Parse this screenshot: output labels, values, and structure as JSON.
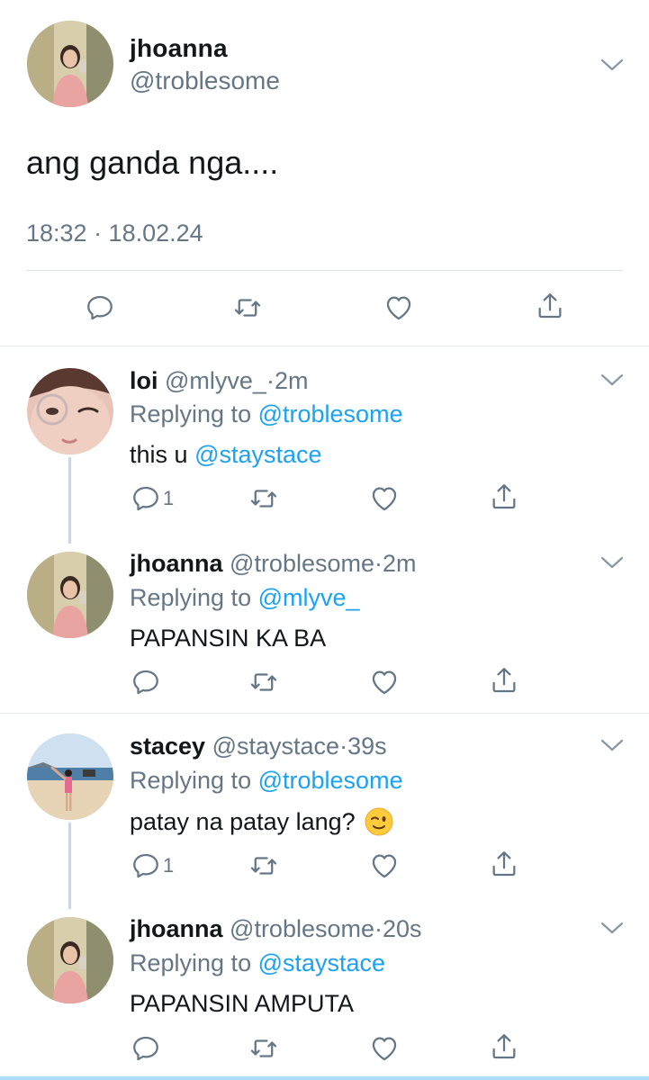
{
  "main_tweet": {
    "name": "jhoanna",
    "handle": "@troblesome",
    "text": "ang ganda nga....",
    "timestamp": "18:32 · 18.02.24",
    "actions": [
      "reply-icon",
      "retweet-icon",
      "like-icon",
      "share-icon"
    ]
  },
  "replies": [
    {
      "name": "loi",
      "handle": "@mlyve_",
      "dot": "·",
      "time": "2m",
      "replying_prefix": "Replying to",
      "replying_to": "@troblesome",
      "text": "this u",
      "text_mention": "@staystace",
      "reply_count": "1"
    },
    {
      "name": "jhoanna",
      "handle": "@troblesome",
      "dot": "·",
      "time": "2m",
      "replying_prefix": "Replying to",
      "replying_to": "@mlyve_",
      "text": "PAPANSIN KA BA"
    },
    {
      "name": "stacey",
      "handle": "@staystace",
      "dot": "·",
      "time": "39s",
      "replying_prefix": "Replying to",
      "replying_to": "@troblesome",
      "text": "patay na patay lang?",
      "emoji": "winking-face-emoji",
      "reply_count": "1"
    },
    {
      "name": "jhoanna",
      "handle": "@troblesome",
      "dot": "·",
      "time": "20s",
      "replying_prefix": "Replying to",
      "replying_to": "@staystace",
      "text": "PAPANSIN AMPUTA"
    }
  ],
  "colors": {
    "accent": "#1da1f2",
    "secondary_text": "#657786",
    "primary_text": "#14171a",
    "divider": "#e1e8ed"
  }
}
